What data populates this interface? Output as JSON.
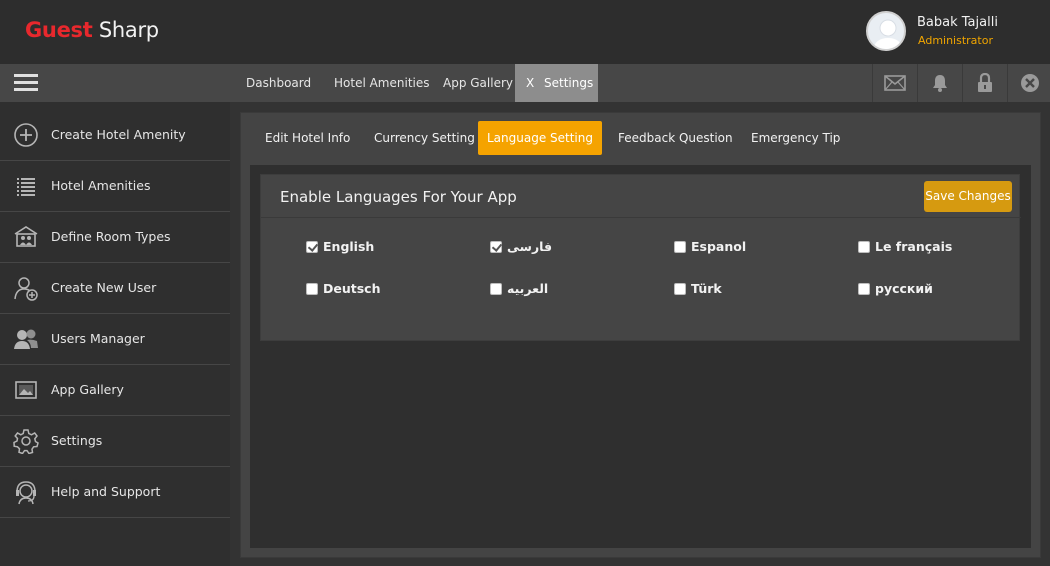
{
  "app": {
    "brand_first": "Guest",
    "brand_second": "Sharp"
  },
  "user": {
    "name": "Babak Tajalli",
    "role": "Administrator"
  },
  "nav": {
    "links": [
      "Dashboard",
      "Hotel Amenities",
      "App Gallery"
    ],
    "active_close": "X",
    "active_label": "Settings",
    "icons": [
      "mail-icon",
      "bell-icon",
      "lock-icon",
      "close-circle-icon"
    ]
  },
  "sidebar": {
    "items": [
      {
        "label": "Create Hotel Amenity",
        "icon": "plus-circle-icon"
      },
      {
        "label": "Hotel Amenities",
        "icon": "list-icon"
      },
      {
        "label": "Define Room Types",
        "icon": "room-types-icon"
      },
      {
        "label": "Create New User",
        "icon": "add-user-icon"
      },
      {
        "label": "Users Manager",
        "icon": "users-icon"
      },
      {
        "label": "App Gallery",
        "icon": "gallery-icon"
      },
      {
        "label": "Settings",
        "icon": "gear-icon"
      },
      {
        "label": "Help and Support",
        "icon": "headset-icon"
      }
    ]
  },
  "tabs": [
    "Edit Hotel Info",
    "Currency Setting",
    "Language Setting",
    "Feedback Question",
    "Emergency Tip"
  ],
  "active_tab": "Language Setting",
  "panel": {
    "title": "Enable Languages For Your App",
    "save_label": "Save Changes"
  },
  "languages": [
    {
      "label": "English",
      "checked": true
    },
    {
      "label": "فارسی",
      "checked": true
    },
    {
      "label": "Espanol",
      "checked": false
    },
    {
      "label": "Le français",
      "checked": false
    },
    {
      "label": "Deutsch",
      "checked": false
    },
    {
      "label": "العربیه",
      "checked": false
    },
    {
      "label": "Türk",
      "checked": false
    },
    {
      "label": "русский",
      "checked": false
    }
  ],
  "colors": {
    "accent": "#f5a300",
    "brand_red": "#e8282d",
    "save_button": "#d69a10"
  }
}
